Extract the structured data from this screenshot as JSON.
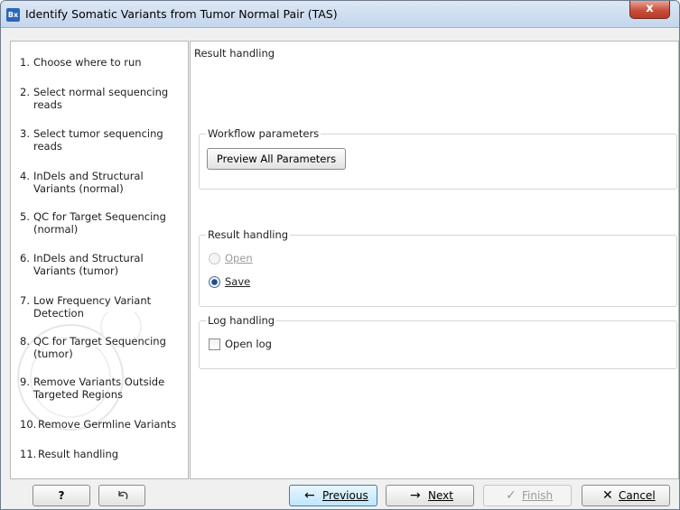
{
  "window": {
    "app_icon": "Bx",
    "title": "Identify Somatic Variants from Tumor Normal Pair (TAS)",
    "close_label": "x"
  },
  "steps": [
    {
      "num": "1.",
      "label": "Choose where to run"
    },
    {
      "num": "2.",
      "label": "Select normal sequencing reads"
    },
    {
      "num": "3.",
      "label": "Select tumor sequencing reads"
    },
    {
      "num": "4.",
      "label": "InDels and Structural Variants (normal)"
    },
    {
      "num": "5.",
      "label": "QC for Target Sequencing (normal)"
    },
    {
      "num": "6.",
      "label": "InDels and Structural Variants (tumor)"
    },
    {
      "num": "7.",
      "label": "Low Frequency Variant Detection"
    },
    {
      "num": "8.",
      "label": "QC for Target Sequencing (tumor)"
    },
    {
      "num": "9.",
      "label": "Remove Variants Outside Targeted Regions"
    },
    {
      "num": "10.",
      "label": "Remove Germline Variants"
    },
    {
      "num": "11.",
      "label": "Result handling"
    }
  ],
  "content": {
    "title": "Result handling",
    "workflow_params": {
      "label": "Workflow parameters",
      "button": "Preview All Parameters"
    },
    "result_handling": {
      "label": "Result handling",
      "open_label": "Open",
      "save_label": "Save",
      "selected": "Save"
    },
    "log_handling": {
      "label": "Log handling",
      "open_log_label": "Open log",
      "open_log_checked": false
    }
  },
  "footer": {
    "help_label": "?",
    "reset_icon": "reset-arrow-icon",
    "previous_label": "Previous",
    "next_label": "Next",
    "finish_label": "Finish",
    "cancel_label": "Cancel"
  }
}
